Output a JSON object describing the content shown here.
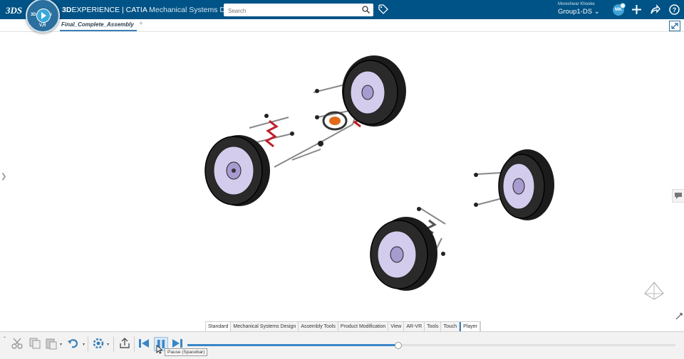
{
  "topbar": {
    "logo": "3DS",
    "brand_3d": "3D",
    "brand_experience": "EXPERIENCE | CATIA",
    "app_name": "Mechanical Systems Design",
    "compass_labels": {
      "left": "3D",
      "right": "i",
      "bottom": "V,R"
    },
    "search": {
      "placeholder": "Search",
      "value": ""
    },
    "user_name": "Moreshwar Khooke",
    "group": "Group1-DS",
    "avatar_initials": "MK",
    "icons": [
      "search-icon",
      "tag-icon",
      "add-icon",
      "share-icon",
      "help-icon"
    ]
  },
  "tabs": {
    "document": "Final_Complete_Assembly",
    "add_label": "+"
  },
  "action_tabs": [
    "Standard",
    "Mechanical Systems Design",
    "Assembly Tools",
    "Product Modification",
    "View",
    "AR-VR",
    "Tools",
    "Touch",
    "Player"
  ],
  "action_tabs_active": "Standard",
  "playback": {
    "progress": 0.43,
    "tooltip": "Pause (Spacebar)"
  },
  "colors": {
    "topbar": "#005386",
    "accent": "#3a86c8",
    "tire": "#1b1b1b",
    "rim": "#c9c0e6",
    "spring": "#c0202a"
  }
}
